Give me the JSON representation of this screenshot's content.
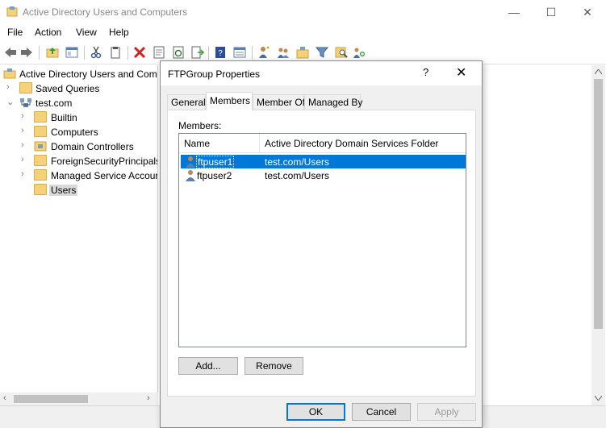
{
  "window": {
    "title": "Active Directory Users and Computers",
    "minimize_glyph": "—",
    "maximize_glyph": "☐",
    "close_glyph": "✕"
  },
  "menu": [
    "File",
    "Action",
    "View",
    "Help"
  ],
  "toolbar": {
    "icons": [
      "back-icon",
      "forward-icon",
      "up-folder-icon",
      "show-hide-tree-icon",
      "cut-icon",
      "copy-icon",
      "delete-icon",
      "properties-icon",
      "refresh-icon",
      "export-list-icon",
      "help-icon",
      "details-view-icon",
      "new-user-icon",
      "new-group-icon",
      "new-ou-icon",
      "filter-icon",
      "find-icon",
      "add-to-group-icon"
    ]
  },
  "tree": {
    "root": "Active Directory Users and Com",
    "items": [
      {
        "label": "Saved Queries",
        "level": 1,
        "expander": "›"
      },
      {
        "label": "test.com",
        "level": 1,
        "expander": "⌄"
      },
      {
        "label": "Builtin",
        "level": 2,
        "expander": "›"
      },
      {
        "label": "Computers",
        "level": 2,
        "expander": "›"
      },
      {
        "label": "Domain Controllers",
        "level": 2,
        "expander": "›"
      },
      {
        "label": "ForeignSecurityPrincipals",
        "level": 2,
        "expander": "›"
      },
      {
        "label": "Managed Service Accour",
        "level": 2,
        "expander": "›"
      },
      {
        "label": "Users",
        "level": 2,
        "expander": ""
      }
    ],
    "scroll_left": "‹",
    "scroll_right": "›"
  },
  "dialog": {
    "title": "FTPGroup Properties",
    "help": "?",
    "close": "✕",
    "tabs": [
      "General",
      "Members",
      "Member Of",
      "Managed By"
    ],
    "active_tab": "Members",
    "members_label": "Members:",
    "columns": [
      "Name",
      "Active Directory Domain Services Folder"
    ],
    "rows": [
      {
        "name": "ftpuser1",
        "folder": "test.com/Users",
        "selected": true
      },
      {
        "name": "ftpuser2",
        "folder": "test.com/Users",
        "selected": false
      }
    ],
    "add_label": "Add...",
    "remove_label": "Remove",
    "ok_label": "OK",
    "cancel_label": "Cancel",
    "apply_label": "Apply"
  },
  "colors": {
    "selection": "#0078d7",
    "folder": "#f3d27a"
  }
}
